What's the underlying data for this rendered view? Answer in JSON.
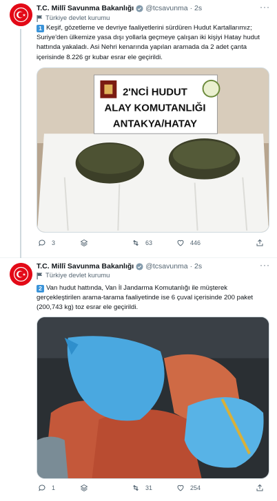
{
  "tweets": [
    {
      "author_name": "T.C. Millî Savunma Bakanlığı",
      "handle": "@tcsavunma",
      "time": "· 2s",
      "label": "Türkiye devlet kurumu",
      "number": "1",
      "text": "Keşif, gözetleme ve devriye faaliyetlerini sürdüren Hudut Kartallarımız; Suriye'den ülkemize yasa dışı yollarla geçmeye çalışan iki kişiyi Hatay hudut hattında yakaladı. Asi Nehri kenarında yapılan aramada da 2 adet çanta içerisinde 8.226 gr kubar esrar ele geçirildi.",
      "sign_lines": [
        "2'NCİ HUDUT",
        "ALAY KOMUTANLIĞI",
        "ANTAKYA/HATAY"
      ],
      "reply_count": "3",
      "retweet_count": "63",
      "like_count": "446"
    },
    {
      "author_name": "T.C. Millî Savunma Bakanlığı",
      "handle": "@tcsavunma",
      "time": "· 2s",
      "label": "Türkiye devlet kurumu",
      "number": "2",
      "text": "Van hudut hattında, Van İl Jandarma Komutanlığı ile müşterek gerçekleştirilen arama-tarama faaliyetinde ise 6 çuval içerisinde 200 paket (200,743 kg) toz esrar ele geçirildi.",
      "reply_count": "1",
      "retweet_count": "31",
      "like_count": "254"
    }
  ],
  "colors": {
    "link_blue": "#1d9bf0",
    "muted": "#536471",
    "brand_red": "#e30a17",
    "emoji_blue": "#3b94d9"
  },
  "icons": [
    "more-icon",
    "verified-badge-icon",
    "government-flag-icon",
    "reply-icon",
    "stack-icon",
    "retweet-icon",
    "like-icon",
    "share-icon"
  ]
}
